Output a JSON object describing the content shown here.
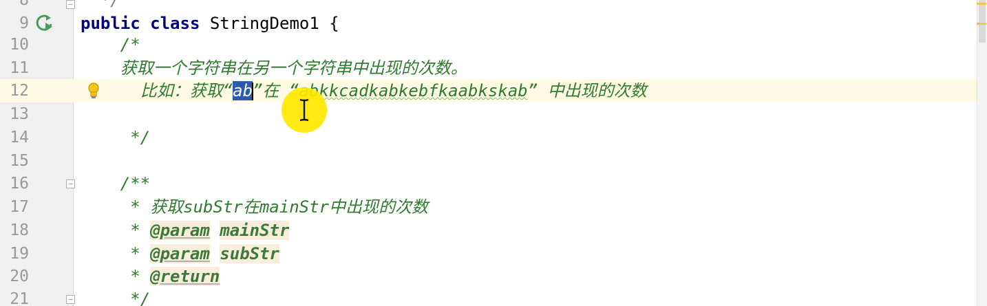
{
  "editor": {
    "lines": [
      {
        "num": "8",
        "text": "  */"
      },
      {
        "num": "9",
        "kw1": "public",
        "kw2": "class",
        "rest": " StringDemo1 {"
      },
      {
        "num": "10",
        "text": "    /*"
      },
      {
        "num": "11",
        "text": "    获取一个字符串在另一个字符串中出现的次数。"
      },
      {
        "num": "12",
        "before": "      比如：获取“",
        "selected": "ab",
        "mid": "”在 “",
        "squiggly": "abkkcadkabkebfkaabkskab",
        "after": "” 中出现的次数"
      },
      {
        "num": "13",
        "text": ""
      },
      {
        "num": "14",
        "text": "     */"
      },
      {
        "num": "15",
        "text": ""
      },
      {
        "num": "16",
        "text": "    /**"
      },
      {
        "num": "17",
        "prefix": "     * ",
        "text": "获取subStr在mainStr中出现的次数"
      },
      {
        "num": "18",
        "prefix": "     * ",
        "tag": "@param",
        "name": "mainStr"
      },
      {
        "num": "19",
        "prefix": "     * ",
        "tag": "@param",
        "name": "subStr"
      },
      {
        "num": "20",
        "prefix": "     * ",
        "tag": "@return"
      },
      {
        "num": "21",
        "text": "     */"
      }
    ]
  },
  "icons": {
    "run": "run-gutter-icon",
    "bulb": "intention-bulb-icon",
    "cursor": "text-cursor-icon"
  },
  "colors": {
    "keyword": "#000080",
    "comment_green": "#3b7a3b",
    "selection": "#2c5bad",
    "current_line": "#fffae3",
    "cursor_highlight": "#ffe800"
  }
}
